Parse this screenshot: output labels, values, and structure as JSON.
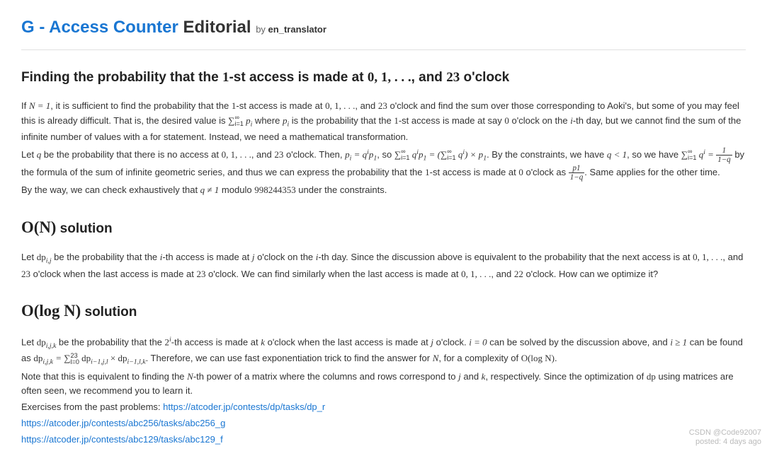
{
  "header": {
    "title_link": "G - Access Counter",
    "title_plain": " Editorial",
    "by": "by ",
    "author": "en_translator"
  },
  "h1": {
    "prefix": "Finding the probability that the ",
    "m1": "1",
    "mid1": "-st access is made at ",
    "m2": "0, 1, . . .",
    "mid2": ", and ",
    "m3": "23",
    "suffix": " o'clock"
  },
  "p1": {
    "t1": "If ",
    "m1": "N = 1",
    "t2": ", it is sufficient to find the probability that the ",
    "m2": "1",
    "t3": "-st access is made at ",
    "m3": "0, 1, . . .",
    "t4": ", and ",
    "m4": "23",
    "t5": " o'clock and find the sum over those corresponding to Aoki's, but some of you may feel this is already difficult. That is, the desired value is ",
    "sum1_sub": "i=1",
    "sum1_sup": "∞",
    "m5": " p",
    "m5sub": "i",
    "t6": " where ",
    "m6": "p",
    "m6sub": "i",
    "t7": " is the probability that the ",
    "m7": "1",
    "t8": "-st access is made at say ",
    "m8": "0",
    "t9": " o'clock on the ",
    "m9": "i",
    "t10": "-th day, but we cannot find the sum of the infinite number of values with a for statement. Instead, we need a mathematical transformation."
  },
  "p2": {
    "t1": "Let ",
    "m1": "q",
    "t2": " be the probability that there is no access at ",
    "m2": "0, 1, . . .",
    "t3": ", and ",
    "m3": "23",
    "t4": " o'clock. Then, ",
    "m4a": "p",
    "m4asub": "i",
    "m4b": " = q",
    "m4bsup": "i",
    "m4c": "p",
    "m4csub": "1",
    "t5": ", so ",
    "sum2_sub": "i=1",
    "sum2_sup": "∞",
    "m5a": " q",
    "m5asup": "i",
    "m5b": "p",
    "m5bsub": "1",
    "m5c": " = (",
    "sum3_sub": "i=1",
    "sum3_sup": "∞",
    "m5d": " q",
    "m5dsup": "i",
    "m5e": ") × p",
    "m5esub": "1",
    "t6": ". By the constraints, we have ",
    "m6": "q < 1",
    "t7": ", so we have ",
    "sum4_sub": "i=1",
    "sum4_sup": "∞",
    "m7a": " q",
    "m7asup": "i",
    "m7b": " = ",
    "frac1_num": "1",
    "frac1_den": "1−q",
    "t8": " by the formula of the sum of infinite geometric series, and thus we can express the probability that the ",
    "m8": "1",
    "t9": "-st access is made at ",
    "m9": "0",
    "t10": " o'clock as ",
    "frac2_num": "p1",
    "frac2_den": "1−q",
    "t11": ". Same applies for the other time."
  },
  "p3": {
    "t1": "By the way, we can check exhaustively that ",
    "m1": "q ≠ 1",
    "t2": " modulo ",
    "m2": "998244353",
    "t3": " under the constraints."
  },
  "h2": {
    "m1": "O(N)",
    "suffix": " solution"
  },
  "p4": {
    "t1": "Let ",
    "m1": "dp",
    "m1sub": "i,j",
    "t2": " be the probability that the ",
    "m2": "i",
    "t3": "-th access is made at ",
    "m3": "j",
    "t4": " o'clock on the ",
    "m4": "i",
    "t5": "-th day. Since the discussion above is equivalent to the probability that the next access is at ",
    "m5": "0, 1, . . .",
    "t6": ", and ",
    "m6": "23",
    "t7": " o'clock when the last access is made at ",
    "m7": "23",
    "t8": " o'clock. We can find similarly when the last access is made at ",
    "m8": "0, 1, . . .",
    "t9": ", and ",
    "m9": "22",
    "t10": " o'clock. How can we optimize it?"
  },
  "h3": {
    "m1": "O(log N)",
    "suffix": " solution"
  },
  "p5": {
    "t1": "Let ",
    "m1": "dp",
    "m1sub": "i,j,k",
    "t2": " be the probability that the ",
    "m2": "2",
    "m2sup": "i",
    "t3": "-th access is made at ",
    "m3": "k",
    "t4": " o'clock when the last access is made at ",
    "m4": "j",
    "t5": " o'clock. ",
    "m5": "i = 0",
    "t6": " can be solved by the discussion above, and ",
    "m6": "i ≥ 1",
    "t7": " can be found as ",
    "m7": "dp",
    "m7sub": "i,j,k",
    "m7b": " = ",
    "sum5_sub": "l=0",
    "sum5_sup": "23",
    "m8a": " dp",
    "m8asub": "i−1,j,l",
    "m8b": " × dp",
    "m8bsub": "i−1,l,k",
    "t8": ". Therefore, we can use fast exponentiation trick to find the answer for ",
    "m9": "N",
    "t9": ", for a complexity of ",
    "m10": "O(log N)",
    "t10": "."
  },
  "p6": {
    "t1": "Note that this is equivalent to finding the ",
    "m1": "N",
    "t2": "-th power of a matrix where the columns and rows correspond to ",
    "m2": "j",
    "t3": " and ",
    "m3": "k",
    "t4": ", respectively. Since the optimization of ",
    "m4": "dp",
    "t5": " using matrices are often seen, we recommend you to learn it."
  },
  "p7": {
    "t1": "Exercises from the past problems: ",
    "link1": "https://atcoder.jp/contests/dp/tasks/dp_r"
  },
  "p8": {
    "link2": "https://atcoder.jp/contests/abc256/tasks/abc256_g"
  },
  "p9": {
    "link3": "https://atcoder.jp/contests/abc129/tasks/abc129_f"
  },
  "watermark": {
    "line1": "CSDN @Code92007",
    "line2": "posted: 4 days ago"
  }
}
